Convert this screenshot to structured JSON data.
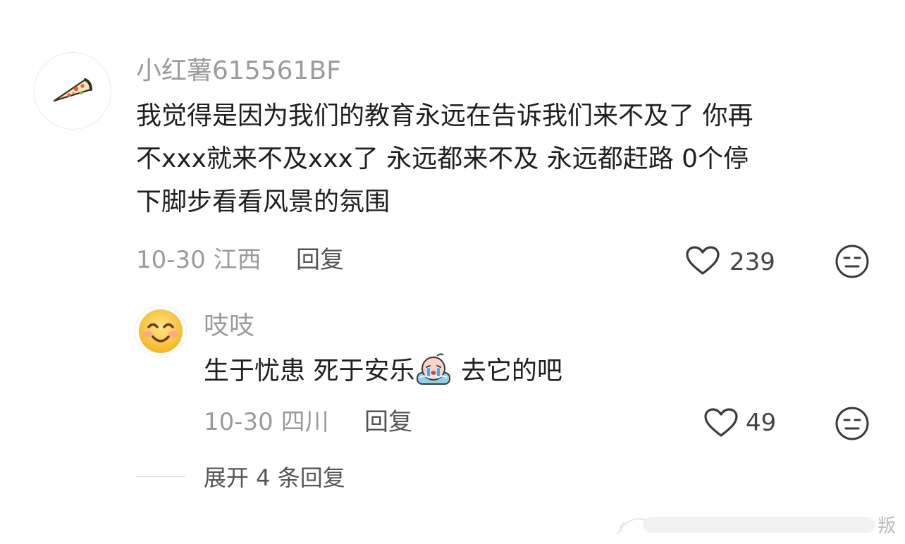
{
  "comment": {
    "username": "小红薯615561BF",
    "text_lines": [
      "我觉得是因为我们的教育永远在告诉我们来不及了 你再",
      "不xxx就来不及xxx了 永远都来不及 永远都赶路 0个停",
      "下脚步看看风景的氛围"
    ],
    "date": "10-30",
    "location": "江西",
    "reply_label": "回复",
    "likes": "239",
    "avatar_icon": "pizza-icon",
    "like_icon": "heart-outline-icon",
    "dislike_icon": "neutral-face-icon"
  },
  "reply": {
    "username": "吱吱",
    "text_before_emoji": "生于忧患 死于安乐",
    "text_after_emoji": " 去它的吧",
    "emoji_icon": "crying-bath-emoji-icon",
    "date": "10-30",
    "location": "四川",
    "reply_label": "回复",
    "likes": "49",
    "avatar_icon": "smiley-icon",
    "like_icon": "heart-outline-icon",
    "dislike_icon": "neutral-face-icon"
  },
  "expand_label": "展开 4 条回复",
  "watermark_text": "叛"
}
